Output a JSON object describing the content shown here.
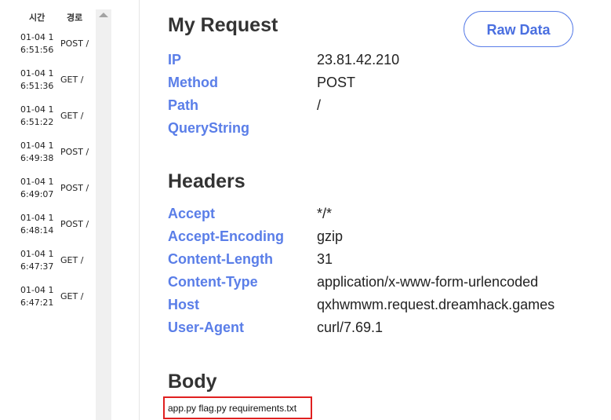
{
  "list": {
    "header_time": "시간",
    "header_path": "경로",
    "items": [
      {
        "date": "01-04 1",
        "time": "6:51:56",
        "method": "POST /"
      },
      {
        "date": "01-04 1",
        "time": "6:51:36",
        "method": "GET /"
      },
      {
        "date": "01-04 1",
        "time": "6:51:22",
        "method": "GET /"
      },
      {
        "date": "01-04 1",
        "time": "6:49:38",
        "method": "POST /"
      },
      {
        "date": "01-04 1",
        "time": "6:49:07",
        "method": "POST /"
      },
      {
        "date": "01-04 1",
        "time": "6:48:14",
        "method": "POST /"
      },
      {
        "date": "01-04 1",
        "time": "6:47:37",
        "method": "GET /"
      },
      {
        "date": "01-04 1",
        "time": "6:47:21",
        "method": "GET /"
      }
    ]
  },
  "raw_button": "Raw Data",
  "request": {
    "title": "My Request",
    "rows": [
      {
        "key": "IP",
        "value": "23.81.42.210"
      },
      {
        "key": "Method",
        "value": "POST"
      },
      {
        "key": "Path",
        "value": "/"
      },
      {
        "key": "QueryString",
        "value": ""
      }
    ]
  },
  "headers": {
    "title": "Headers",
    "rows": [
      {
        "key": "Accept",
        "value": "*/*"
      },
      {
        "key": "Accept-Encoding",
        "value": "gzip"
      },
      {
        "key": "Content-Length",
        "value": "31"
      },
      {
        "key": "Content-Type",
        "value": "application/x-www-form-urlencoded"
      },
      {
        "key": "Host",
        "value": "qxhwmwm.request.dreamhack.games"
      },
      {
        "key": "User-Agent",
        "value": "curl/7.69.1"
      }
    ]
  },
  "body": {
    "title": "Body",
    "content": "app.py flag.py requirements.txt"
  },
  "colors": {
    "key": "#5a7ee8",
    "highlight_border": "#e02020"
  }
}
